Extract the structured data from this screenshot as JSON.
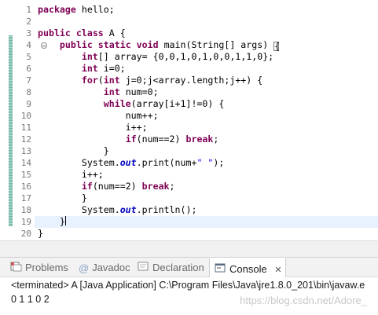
{
  "editor": {
    "line_numbers": [
      "1",
      "2",
      "3",
      "4",
      "5",
      "6",
      "7",
      "8",
      "9",
      "10",
      "11",
      "12",
      "13",
      "14",
      "15",
      "16",
      "17",
      "18",
      "19",
      "20"
    ],
    "lines": [
      "package hello;",
      "",
      "public class A {",
      "    public static void main(String[] args) {",
      "        int[] array= {0,0,1,0,1,0,0,1,1,0};",
      "        int i=0;",
      "        for(int j=0;j<array.length;j++) {",
      "            int num=0;",
      "            while(array[i+1]!=0) {",
      "                num++;",
      "                i++;",
      "                if(num==2) break;",
      "            }",
      "        System.out.print(num+\" \");",
      "        i++;",
      "        if(num==2) break;",
      "        }",
      "        System.out.println();",
      "    }",
      "}"
    ],
    "colors": {
      "keyword": "#7f0055",
      "string": "#2a00ff",
      "static_field": "#0000c0",
      "current_line": "#e8f2fe",
      "line_number": "#787878"
    }
  },
  "tabs": [
    {
      "label": "Problems",
      "icon": "problems-icon",
      "active": false
    },
    {
      "label": "Javadoc",
      "icon": "javadoc-icon",
      "active": false
    },
    {
      "label": "Declaration",
      "icon": "declaration-icon",
      "active": false
    },
    {
      "label": "Console",
      "icon": "console-icon",
      "active": true,
      "close": "✕"
    }
  ],
  "console": {
    "status": "<terminated> A [Java Application] C:\\Program Files\\Java\\jre1.8.0_201\\bin\\javaw.e",
    "output": "0 1 1 0 2"
  },
  "watermark": "https://blog.csdn.net/Adore_"
}
